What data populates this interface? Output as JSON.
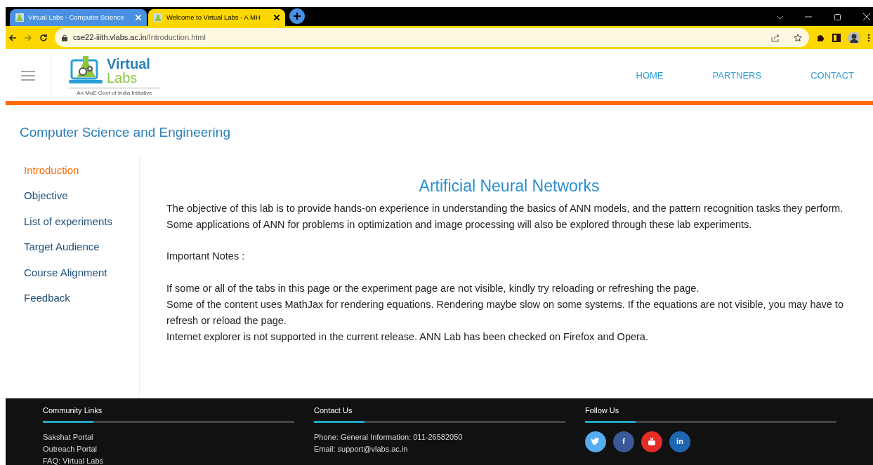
{
  "browser": {
    "tabs": [
      {
        "title": "Virtual Labs - Computer Science",
        "selected": false
      },
      {
        "title": "Welcome to Virtual Labs - A MH",
        "selected": true
      }
    ],
    "url_host": "cse22-iiith.vlabs.ac.in",
    "url_path": "/Introduction.html"
  },
  "header": {
    "logo": {
      "line1": "Virtual",
      "line2": "Labs",
      "tagline": "An MoE Govt of India Initiative"
    },
    "nav": [
      "HOME",
      "PARTNERS",
      "CONTACT"
    ]
  },
  "department": "Computer Science and Engineering",
  "sidebar": {
    "items": [
      {
        "label": "Introduction",
        "selected": true
      },
      {
        "label": "Objective",
        "selected": false
      },
      {
        "label": "List of experiments",
        "selected": false
      },
      {
        "label": "Target Audience",
        "selected": false
      },
      {
        "label": "Course Alignment",
        "selected": false
      },
      {
        "label": "Feedback",
        "selected": false
      }
    ]
  },
  "content": {
    "title": "Artificial Neural Networks",
    "intro": "The objective of this lab is to provide hands-on experience in understanding the basics of ANN models, and the pattern recognition tasks they perform. Some applications of ANN for problems in optimization and image processing will also be explored through these lab experiments.",
    "notes_heading": "Important Notes :",
    "notes": [
      "If some or all of the tabs in this page or the experiment page are not visible, kindly try reloading or refreshing the page.",
      "Some of the content uses MathJax for rendering equations. Rendering maybe slow on some systems. If the equations are not visible, you may have to refresh or reload the page.",
      "Internet explorer is not supported in the current release. ANN Lab has been checked on Firefox and Opera."
    ]
  },
  "footer": {
    "community": {
      "heading": "Community Links",
      "links": [
        "Sakshat Portal",
        "Outreach Portal",
        "FAQ: Virtual Labs"
      ]
    },
    "contact": {
      "heading": "Contact Us",
      "lines": [
        "Phone: General Information: 011-26582050",
        "Email: support@vlabs.ac.in"
      ]
    },
    "follow": {
      "heading": "Follow Us",
      "social": [
        {
          "kind": "twitter",
          "color": "#55acee"
        },
        {
          "kind": "facebook",
          "label": "f",
          "color": "#3b5998"
        },
        {
          "kind": "youtube",
          "color": "#e52d27"
        },
        {
          "kind": "linkedin",
          "label": "in",
          "color": "#1f66b1"
        }
      ]
    }
  }
}
